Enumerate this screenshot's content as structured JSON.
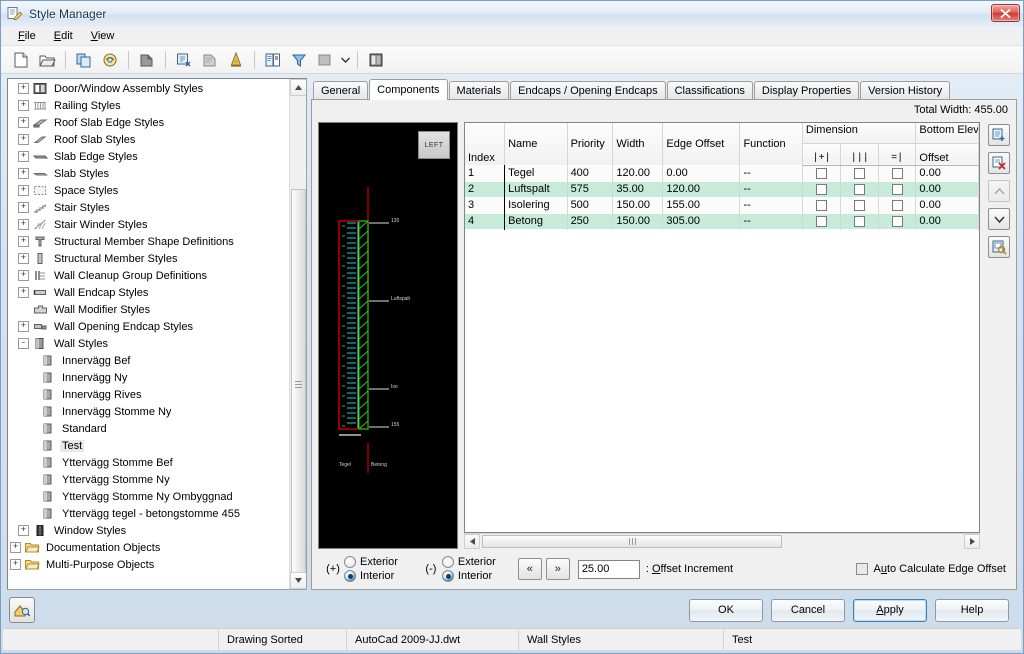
{
  "window": {
    "title": "Style Manager",
    "icon": "style-manager-icon",
    "close_label": "Close"
  },
  "menu": {
    "items": [
      {
        "label": "File",
        "mnemonic": "F"
      },
      {
        "label": "Edit",
        "mnemonic": "E"
      },
      {
        "label": "View",
        "mnemonic": "V"
      }
    ]
  },
  "toolbar": {
    "buttons": [
      {
        "name": "new-drawing-icon",
        "title": "New Drawing"
      },
      {
        "name": "open-drawing-icon",
        "title": "Open Drawing"
      },
      {
        "name": "copy-icon",
        "title": "Copy"
      },
      {
        "name": "paste-icon",
        "title": "Paste"
      },
      {
        "name": "edit-style-icon",
        "title": "Edit Style"
      },
      {
        "name": "purge-style-icon",
        "title": "Purge Style"
      },
      {
        "name": "new-style-icon",
        "title": "New Style"
      },
      {
        "name": "set-from-icon",
        "title": "Set From"
      },
      {
        "name": "toggle-view-icon",
        "title": "Toggle View"
      },
      {
        "name": "filter-style-type-icon",
        "title": "Filter Style Type"
      },
      {
        "name": "view-mode-icon",
        "title": "Viewer Toggle"
      },
      {
        "name": "inline-edit-icon",
        "title": "Inline Edit Toggle"
      }
    ]
  },
  "tree": {
    "items": [
      {
        "label": "Door/Window Assembly Styles",
        "depth": 1,
        "expander": "+",
        "icon": "door-window-assembly-icon"
      },
      {
        "label": "Railing Styles",
        "depth": 1,
        "expander": "+",
        "icon": "railing-icon"
      },
      {
        "label": "Roof Slab Edge Styles",
        "depth": 1,
        "expander": "+",
        "icon": "roof-slab-edge-icon"
      },
      {
        "label": "Roof Slab Styles",
        "depth": 1,
        "expander": "+",
        "icon": "roof-slab-icon"
      },
      {
        "label": "Slab Edge Styles",
        "depth": 1,
        "expander": "+",
        "icon": "slab-edge-icon"
      },
      {
        "label": "Slab Styles",
        "depth": 1,
        "expander": "+",
        "icon": "slab-icon"
      },
      {
        "label": "Space Styles",
        "depth": 1,
        "expander": "+",
        "icon": "space-icon"
      },
      {
        "label": "Stair Styles",
        "depth": 1,
        "expander": "+",
        "icon": "stair-icon"
      },
      {
        "label": "Stair Winder Styles",
        "depth": 1,
        "expander": "+",
        "icon": "stair-winder-icon"
      },
      {
        "label": "Structural Member Shape Definitions",
        "depth": 1,
        "expander": "+",
        "icon": "structural-shape-icon"
      },
      {
        "label": "Structural Member Styles",
        "depth": 1,
        "expander": "+",
        "icon": "structural-member-icon"
      },
      {
        "label": "Wall Cleanup Group Definitions",
        "depth": 1,
        "expander": "+",
        "icon": "wall-cleanup-icon"
      },
      {
        "label": "Wall Endcap Styles",
        "depth": 1,
        "expander": "+",
        "icon": "wall-endcap-icon"
      },
      {
        "label": "Wall Modifier Styles",
        "depth": 1,
        "expander": "",
        "icon": "wall-modifier-icon"
      },
      {
        "label": "Wall Opening Endcap Styles",
        "depth": 1,
        "expander": "+",
        "icon": "wall-opening-endcap-icon"
      },
      {
        "label": "Wall Styles",
        "depth": 1,
        "expander": "-",
        "icon": "wall-styles-icon"
      },
      {
        "label": "Innervägg Bef",
        "depth": 2,
        "expander": "",
        "icon": "wall-style-icon"
      },
      {
        "label": "Innervägg Ny",
        "depth": 2,
        "expander": "",
        "icon": "wall-style-icon"
      },
      {
        "label": "Innervägg Rives",
        "depth": 2,
        "expander": "",
        "icon": "wall-style-icon"
      },
      {
        "label": "Innervägg Stomme  Ny",
        "depth": 2,
        "expander": "",
        "icon": "wall-style-icon"
      },
      {
        "label": "Standard",
        "depth": 2,
        "expander": "",
        "icon": "wall-style-icon"
      },
      {
        "label": "Test",
        "depth": 2,
        "expander": "",
        "icon": "wall-style-icon",
        "selected": true
      },
      {
        "label": "Yttervägg Stomme Bef",
        "depth": 2,
        "expander": "",
        "icon": "wall-style-icon"
      },
      {
        "label": "Yttervägg Stomme Ny",
        "depth": 2,
        "expander": "",
        "icon": "wall-style-icon"
      },
      {
        "label": "Yttervägg Stomme Ny Ombyggnad",
        "depth": 2,
        "expander": "",
        "icon": "wall-style-icon"
      },
      {
        "label": "Yttervägg tegel - betongstomme 455",
        "depth": 2,
        "expander": "",
        "icon": "wall-style-icon"
      },
      {
        "label": "Window Styles",
        "depth": 1,
        "expander": "+",
        "icon": "window-styles-icon"
      },
      {
        "label": "Documentation Objects",
        "depth": 0,
        "expander": "+",
        "icon": "folder-icon"
      },
      {
        "label": "Multi-Purpose Objects",
        "depth": 0,
        "expander": "+",
        "icon": "folder-icon"
      }
    ]
  },
  "tabs": [
    {
      "label": "General",
      "active": false
    },
    {
      "label": "Components",
      "active": true
    },
    {
      "label": "Materials",
      "active": false
    },
    {
      "label": "Endcaps / Opening Endcaps",
      "active": false
    },
    {
      "label": "Classifications",
      "active": false
    },
    {
      "label": "Display Properties",
      "active": false
    },
    {
      "label": "Version History",
      "active": false
    }
  ],
  "components": {
    "total_width_label": "Total Width: 455.00",
    "preview": {
      "view_label": "LEFT",
      "dim_labels": [
        "120",
        "Luftspalt",
        "Iso",
        "155"
      ],
      "bottom_labels": [
        "Tegel",
        "Betong"
      ]
    },
    "columns": {
      "index": "Index",
      "name": "Name",
      "priority": "Priority",
      "width": "Width",
      "edge_offset": "Edge Offset",
      "function": "Function",
      "dimension_group": "Dimension",
      "dimension_sub": [
        "|+|",
        "|||",
        "=|"
      ],
      "bottom_elev_group": "Bottom Elev",
      "bottom_elev_sub": "Offset"
    },
    "rows": [
      {
        "index": "1",
        "name": "Tegel",
        "priority": "400",
        "width": "120.00",
        "edge_offset": "0.00",
        "function": "--",
        "dim1": false,
        "dim2": false,
        "dim3": false,
        "bottom_offset": "0.00"
      },
      {
        "index": "2",
        "name": "Luftspalt",
        "priority": "575",
        "width": "35.00",
        "edge_offset": "120.00",
        "function": "--",
        "dim1": false,
        "dim2": false,
        "dim3": false,
        "bottom_offset": "0.00"
      },
      {
        "index": "3",
        "name": "Isolering",
        "priority": "500",
        "width": "150.00",
        "edge_offset": "155.00",
        "function": "--",
        "dim1": false,
        "dim2": false,
        "dim3": false,
        "bottom_offset": "0.00"
      },
      {
        "index": "4",
        "name": "Betong",
        "priority": "250",
        "width": "150.00",
        "edge_offset": "305.00",
        "function": "--",
        "dim1": false,
        "dim2": false,
        "dim3": false,
        "bottom_offset": "0.00"
      }
    ],
    "side_buttons": [
      {
        "name": "add-component-button",
        "title": "Add Component",
        "disabled": false
      },
      {
        "name": "remove-component-button",
        "title": "Remove Component",
        "disabled": false
      },
      {
        "name": "move-up-button",
        "title": "Move Component Up",
        "disabled": true
      },
      {
        "name": "move-down-button",
        "title": "Move Component Down",
        "disabled": false
      },
      {
        "name": "copy-component-button",
        "title": "Copy Component",
        "disabled": false
      }
    ],
    "options": {
      "plus_sign": "(+)",
      "minus_sign": "(-)",
      "plus_group": {
        "exterior": "Exterior",
        "interior": "Interior",
        "selected": "Interior"
      },
      "minus_group": {
        "exterior": "Exterior",
        "interior": "Interior",
        "selected": "Interior"
      },
      "prev_label": "«",
      "next_label": "»",
      "offset_increment_value": "25.00",
      "offset_increment_label": ": Offset Increment",
      "offset_increment_mnemonic": "O",
      "auto_calc_label": "Auto Calculate Edge Offset",
      "auto_calc_mnemonic": "u",
      "auto_calc_checked": false
    }
  },
  "dialog_buttons": [
    {
      "label": "OK",
      "name": "ok-button",
      "default": false
    },
    {
      "label": "Cancel",
      "name": "cancel-button",
      "default": false
    },
    {
      "label": "Apply",
      "name": "apply-button",
      "default": true,
      "mnemonic": "A"
    },
    {
      "label": "Help",
      "name": "help-button",
      "default": false
    }
  ],
  "status_bar": {
    "cells": [
      "",
      "Drawing Sorted",
      "AutoCad 2009-JJ.dwt",
      "Wall Styles",
      "Test"
    ]
  },
  "colors": {
    "row_highlight": "#c6ebd8",
    "selection": "#e8e8e8",
    "default_button_border": "#3c7fb1",
    "title_text": "#12314f",
    "preview_bg": "#000000",
    "preview_red": "#ff0000",
    "preview_green": "#00ff00",
    "preview_cyan": "#00e5e5"
  }
}
